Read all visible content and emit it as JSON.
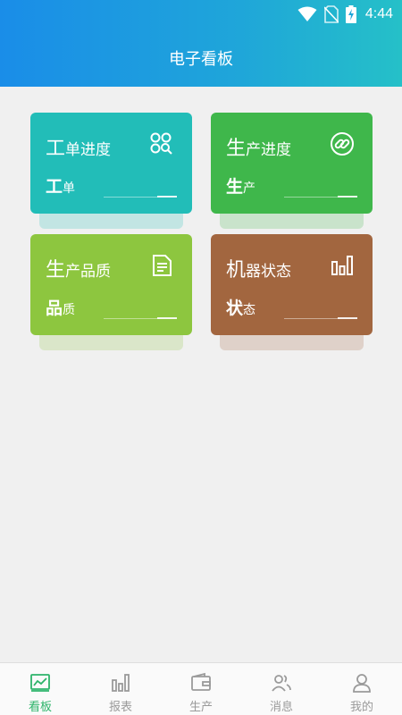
{
  "status_bar": {
    "time": "4:44",
    "icons": [
      "wifi-icon",
      "no-sim-icon",
      "battery-charging-icon"
    ]
  },
  "header": {
    "title": "电子看板"
  },
  "cards": [
    {
      "title_big": "工",
      "title_small": "单进度",
      "sub_big": "工",
      "sub_small": "单",
      "icon": "search-apps-icon",
      "color": "#22bdb8"
    },
    {
      "title_big": "生",
      "title_small": "产进度",
      "sub_big": "生",
      "sub_small": "产",
      "icon": "link-icon",
      "color": "#3fb74b"
    },
    {
      "title_big": "生",
      "title_small": "产品质",
      "sub_big": "品",
      "sub_small": "质",
      "icon": "document-icon",
      "color": "#8dc63f"
    },
    {
      "title_big": "机",
      "title_small": "器状态",
      "sub_big": "状",
      "sub_small": "态",
      "icon": "bar-chart-icon",
      "color": "#a2663f"
    }
  ],
  "nav": {
    "active_color": "#2db46a",
    "items": [
      {
        "label": "看板",
        "icon": "dashboard-icon",
        "active": true
      },
      {
        "label": "报表",
        "icon": "report-icon",
        "active": false
      },
      {
        "label": "生产",
        "icon": "wallet-icon",
        "active": false
      },
      {
        "label": "消息",
        "icon": "contacts-icon",
        "active": false
      },
      {
        "label": "我的",
        "icon": "person-icon",
        "active": false
      }
    ]
  }
}
